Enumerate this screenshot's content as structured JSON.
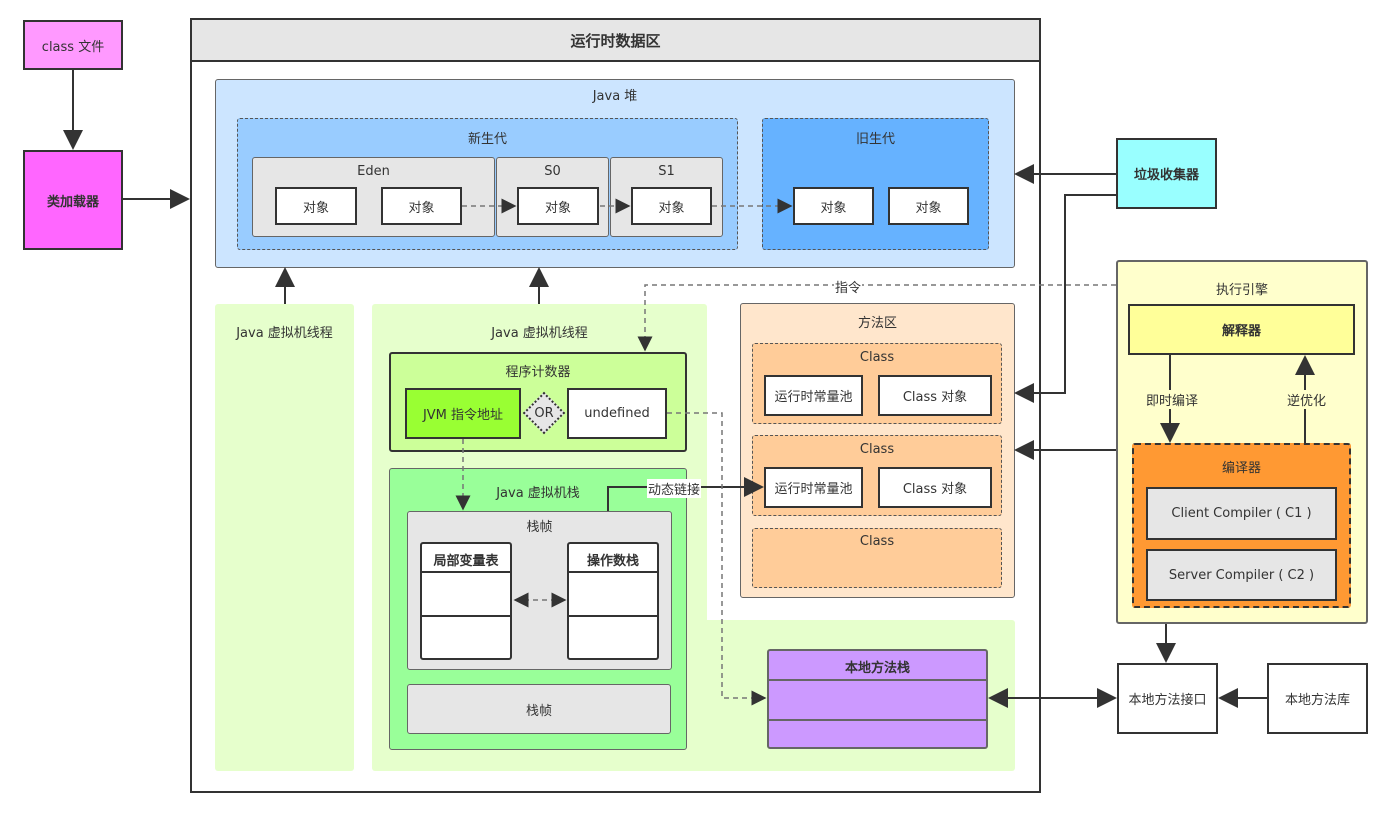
{
  "class_file": "class 文件",
  "class_loader": "类加载器",
  "runtime": {
    "title": "运行时数据区",
    "heap": {
      "title": "Java 堆",
      "young": "新生代",
      "old": "旧生代",
      "eden": "Eden",
      "s0": "S0",
      "s1": "S1",
      "object": "对象"
    },
    "thread1": "Java 虚拟机线程",
    "thread2": "Java 虚拟机线程",
    "pc": {
      "title": "程序计数器",
      "jvm_addr": "JVM 指令地址",
      "or": "OR",
      "undefined": "undefined"
    },
    "vm_stack": {
      "title": "Java 虚拟机栈",
      "frame": "栈帧",
      "locals": "局部变量表",
      "operands": "操作数栈"
    },
    "method_area": {
      "title": "方法区",
      "class": "Class",
      "pool": "运行时常量池",
      "class_obj": "Class 对象"
    },
    "native_stack": "本地方法栈",
    "labels": {
      "instruction": "指令",
      "dynamic_link": "动态链接"
    }
  },
  "gc": "垃圾收集器",
  "engine": {
    "title": "执行引擎",
    "interpreter": "解释器",
    "compiler": "编译器",
    "c1": "Client Compiler ( C1 )",
    "c2": "Server Compiler ( C2 )",
    "jit": "即时编译",
    "deopt": "逆优化"
  },
  "native_interface": "本地方法接口",
  "native_lib": "本地方法库",
  "colors": {
    "class_file": "#ff99ff",
    "loader": "#ff66ff",
    "heap": "#cce5ff",
    "young": "#99ccff",
    "old": "#66b2ff",
    "thread": "#e6ffcc",
    "pc": "#ccff99",
    "jvm_addr": "#99ff33",
    "vm_stack": "#99ff99",
    "method_area": "#ffe6cc",
    "class": "#ffcc99",
    "native_stack": "#cc99ff",
    "gc": "#99ffff",
    "engine": "#ffffcc",
    "interpreter": "#ffff99",
    "compiler": "#ff9933"
  }
}
